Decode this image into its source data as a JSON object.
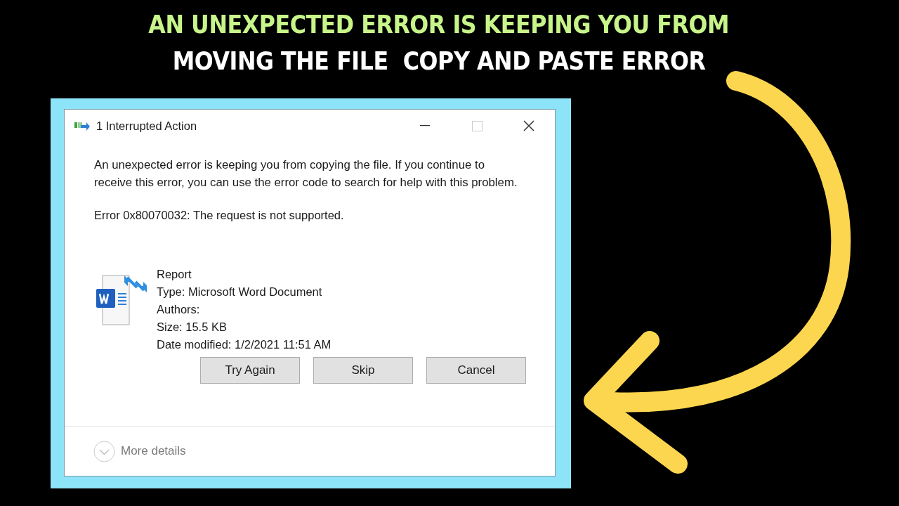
{
  "headline": [
    {
      "text": "AN UNEXPECTED ERROR IS KEEPING YOU FROM",
      "color": "#c8f58a"
    },
    {
      "text": "MOVING THE FILE  COPY AND PASTE ERROR",
      "color": "#ffffff"
    }
  ],
  "dialog": {
    "title": "1 Interrupted Action",
    "message": "An unexpected error is keeping you from copying the file. If you continue to receive this error, you can use the error code to search for help with this problem.",
    "error": "Error 0x80070032: The request is not supported.",
    "file": {
      "name": "Report",
      "details": [
        "Type: Microsoft Word Document",
        "Authors:",
        "Size: 15.5 KB",
        "Date modified: 1/2/2021 11:51 AM"
      ]
    },
    "buttons": [
      "Try Again",
      "Skip",
      "Cancel"
    ],
    "more_details": "More details"
  }
}
